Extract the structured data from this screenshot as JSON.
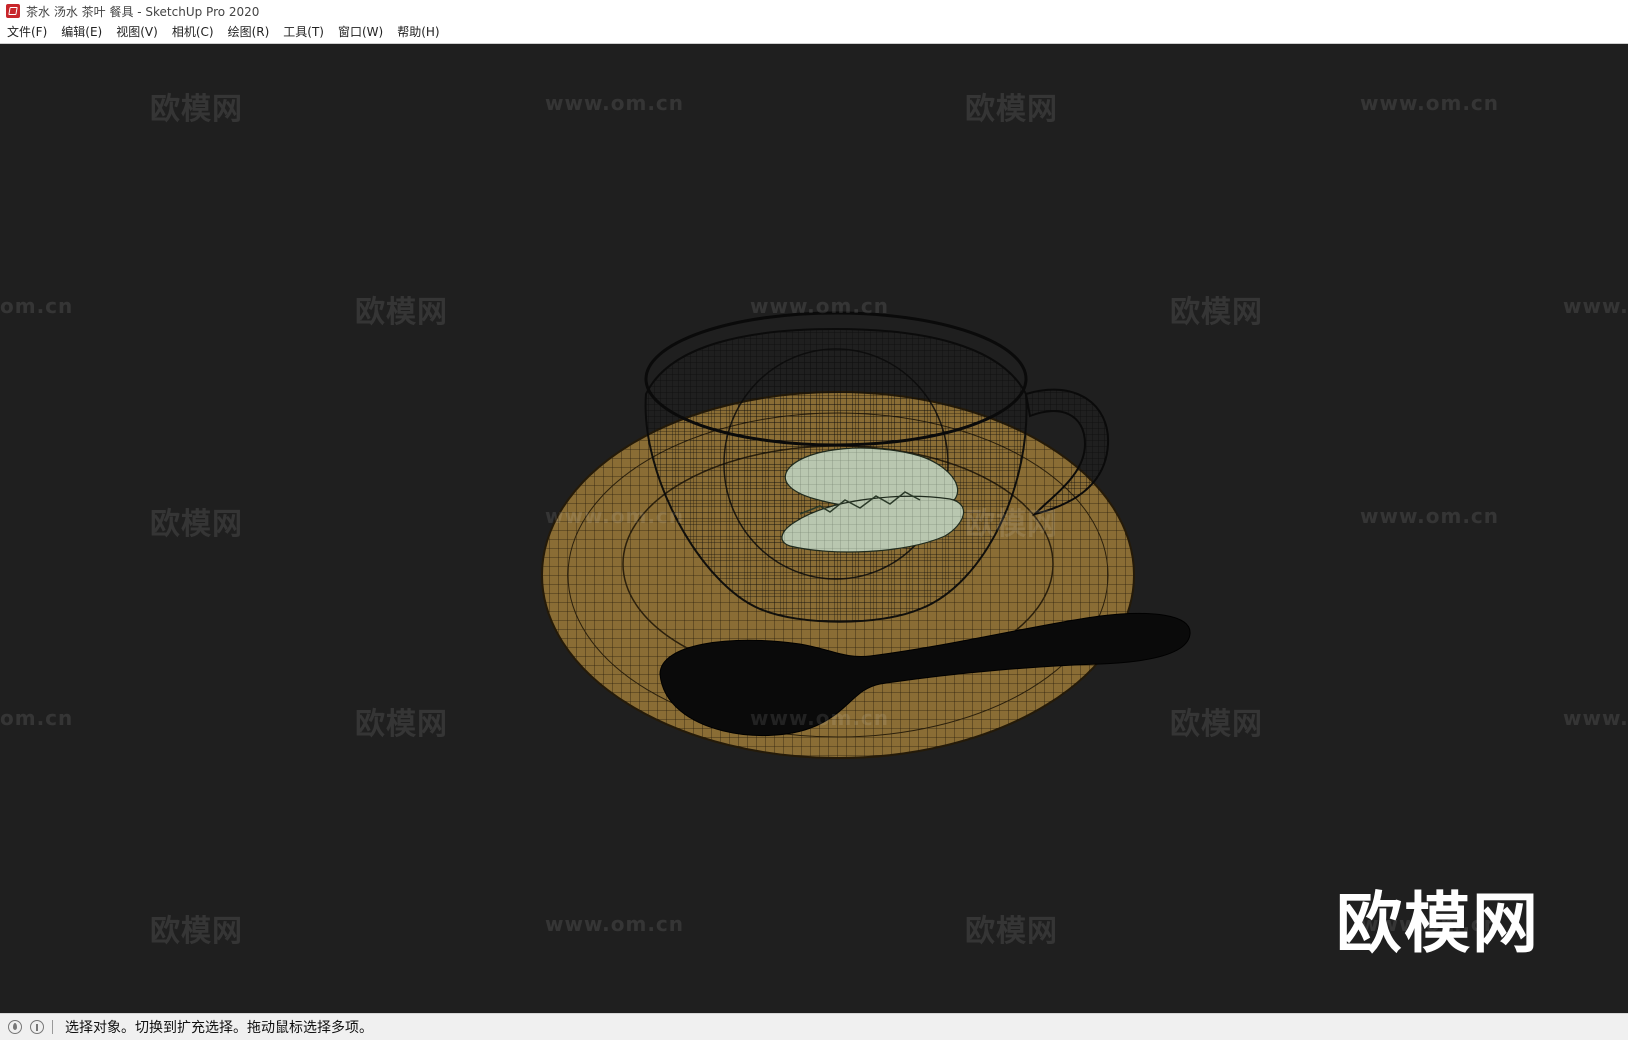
{
  "window": {
    "title": "茶水 汤水 茶叶 餐具 - SketchUp Pro 2020"
  },
  "menu": {
    "items": [
      {
        "label": "文件(F)",
        "name": "menu-file"
      },
      {
        "label": "编辑(E)",
        "name": "menu-edit"
      },
      {
        "label": "视图(V)",
        "name": "menu-view"
      },
      {
        "label": "相机(C)",
        "name": "menu-camera"
      },
      {
        "label": "绘图(R)",
        "name": "menu-draw"
      },
      {
        "label": "工具(T)",
        "name": "menu-tools"
      },
      {
        "label": "窗口(W)",
        "name": "menu-window"
      },
      {
        "label": "帮助(H)",
        "name": "menu-help"
      }
    ]
  },
  "watermark": {
    "brand": "欧模网",
    "url": "www.om.cn",
    "url_partial": "om.cn",
    "url_prefix": "www."
  },
  "status": {
    "message": "选择对象。切换到扩充选择。拖动鼠标选择多项。"
  },
  "colors": {
    "viewport_bg": "#1f1f1f",
    "saucer": "#8a6d35",
    "leaf": "#b9c7b0",
    "spoon": "#0a0a0a"
  }
}
